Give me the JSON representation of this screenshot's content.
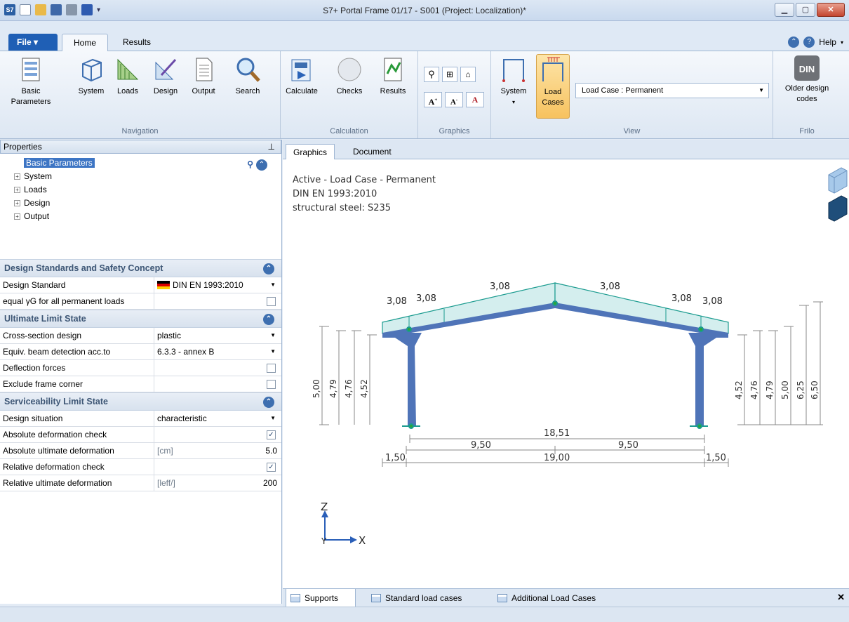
{
  "window": {
    "title": "S7+ Portal Frame 01/17 - S001 (Project: Localization)*",
    "app_icon": "S7"
  },
  "ribbon_tabs": {
    "file": "File",
    "home": "Home",
    "results": "Results",
    "help": "Help"
  },
  "ribbon": {
    "navigation": {
      "label": "Navigation",
      "buttons": [
        "Basic Parameters",
        "System",
        "Loads",
        "Design",
        "Output",
        "Search"
      ]
    },
    "calculation": {
      "label": "Calculation",
      "buttons": [
        "Calculate",
        "Checks",
        "Results"
      ]
    },
    "graphics": {
      "label": "Graphics"
    },
    "view": {
      "label": "View",
      "system": "System",
      "load_cases": "Load Cases",
      "load_case_select": "Load Case   : Permanent"
    },
    "frilo": {
      "label": "Frilo",
      "older": "Older design codes",
      "din": "DIN"
    }
  },
  "properties": {
    "header": "Properties",
    "tree": [
      "Basic Parameters",
      "System",
      "Loads",
      "Design",
      "Output"
    ]
  },
  "sections": {
    "design_standards": "Design Standards and Safety Concept",
    "uls": "Ultimate Limit State",
    "sls": "Serviceability Limit State"
  },
  "props": {
    "design_standard": {
      "label": "Design Standard",
      "value": "DIN EN 1993:2010"
    },
    "equal_yg": {
      "label": "equal γG for all permanent loads",
      "checked": false
    },
    "cross_section": {
      "label": "Cross-section design",
      "value": "plastic"
    },
    "equiv_beam": {
      "label": "Equiv. beam detection acc.to",
      "value": "6.3.3 - annex B"
    },
    "defl_forces": {
      "label": "Deflection forces",
      "checked": false
    },
    "excl_corner": {
      "label": "Exclude frame corner",
      "checked": false
    },
    "design_situation": {
      "label": "Design situation",
      "value": "characteristic"
    },
    "abs_def_check": {
      "label": "Absolute deformation check",
      "checked": true
    },
    "abs_ult_def": {
      "label": "Absolute ultimate deformation",
      "unit": "[cm]",
      "value": "5.0"
    },
    "rel_def_check": {
      "label": "Relative deformation check",
      "checked": true
    },
    "rel_ult_def": {
      "label": "Relative ultimate deformation",
      "unit": "[leff/]",
      "value": "200"
    }
  },
  "view_tabs": {
    "graphics": "Graphics",
    "document": "Document"
  },
  "info": {
    "line1": "Active - Load Case - Permanent",
    "line2": "DIN EN 1993:2010",
    "line3": "structural steel: S235"
  },
  "drawing_labels": {
    "loads": [
      "3,08",
      "3,08",
      "3,08",
      "3,08",
      "3,08",
      "3,08"
    ],
    "left_heights": [
      "5,00",
      "4,79",
      "4,76",
      "4,52"
    ],
    "right_heights": [
      "4,52",
      "4,76",
      "4,79",
      "5,00",
      "6,25",
      "6,50"
    ],
    "spans": {
      "total_inner": "18,51",
      "half_left": "9,50",
      "half_right": "9,50",
      "overhang_left": "1,50",
      "overall": "19,00",
      "overhang_right": "1,50"
    },
    "axis_z": "Z",
    "axis_x": "X",
    "axis_y": "Y"
  },
  "bottom_tabs": [
    "Supports",
    "Standard load cases",
    "Additional Load Cases"
  ]
}
